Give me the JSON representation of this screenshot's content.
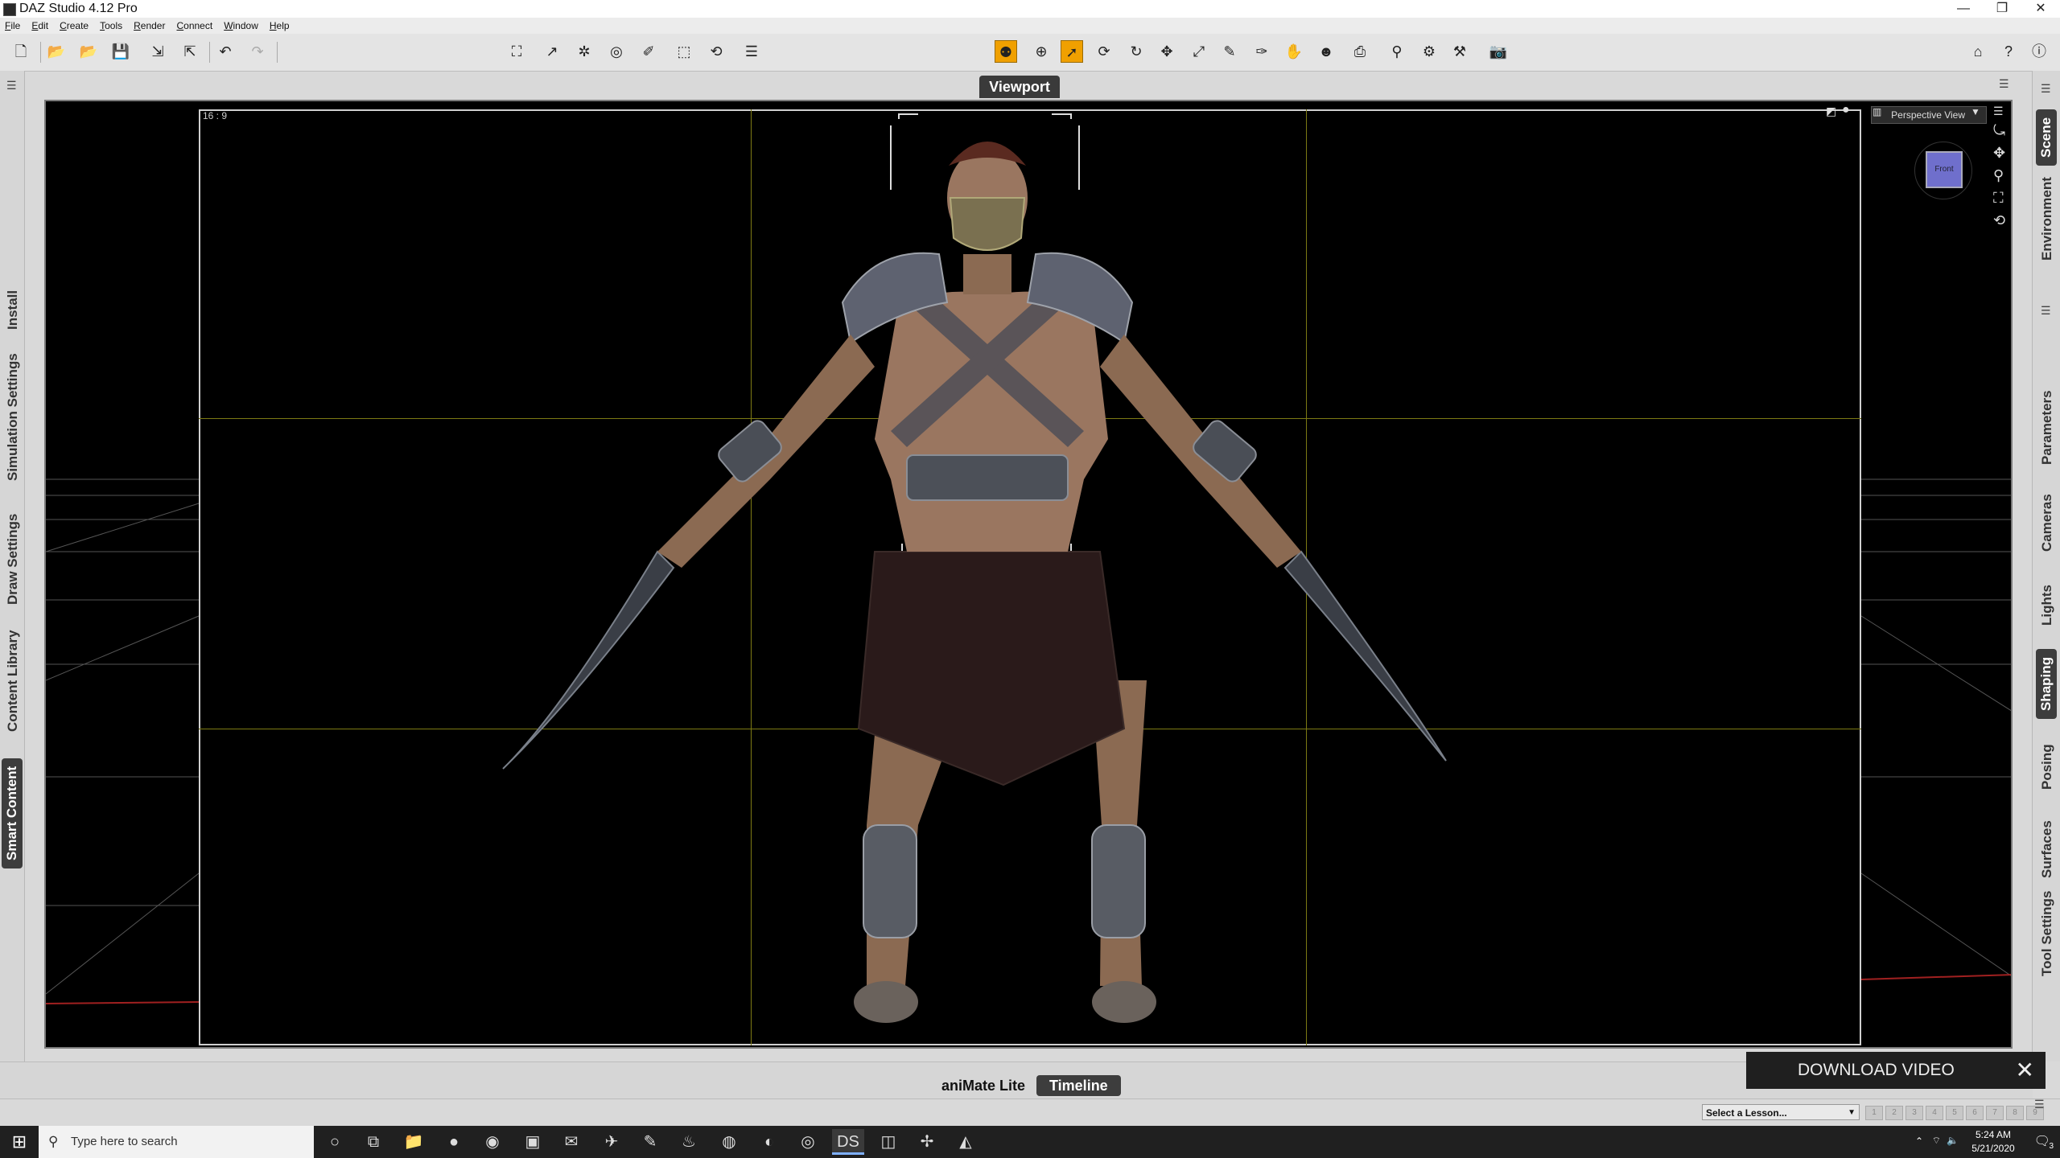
{
  "window": {
    "title": "DAZ Studio 4.12 Pro",
    "min": "—",
    "max": "❐",
    "close": "✕"
  },
  "menu": [
    "File",
    "Edit",
    "Create",
    "Tools",
    "Render",
    "Connect",
    "Window",
    "Help"
  ],
  "left_tabs": [
    "Install",
    "Simulation Settings",
    "Draw Settings",
    "Content Library",
    "Smart Content"
  ],
  "right_tabs": [
    "Scene",
    "Environment",
    "Parameters",
    "Cameras",
    "Lights",
    "Shaping",
    "Posing",
    "Surfaces",
    "Tool Settings"
  ],
  "viewport": {
    "tab_label": "Viewport",
    "aspect_label": "16 : 9",
    "view_label": "Perspective View",
    "cube_label": "Front"
  },
  "bottom_tabs": [
    "aniMate Lite",
    "Timeline"
  ],
  "download": {
    "label": "DOWNLOAD VIDEO",
    "close": "✕"
  },
  "lesson": {
    "placeholder": "Select a Lesson...",
    "steps": [
      "1",
      "2",
      "3",
      "4",
      "5",
      "6",
      "7",
      "8",
      "9"
    ]
  },
  "taskbar": {
    "search_placeholder": "Type here to search",
    "time": "5:24 AM",
    "date": "5/21/2020",
    "notifications": "3"
  },
  "colors": {
    "accent": "#f0a000",
    "guide": "#7d7a14",
    "viewport_bg": "#000000"
  }
}
